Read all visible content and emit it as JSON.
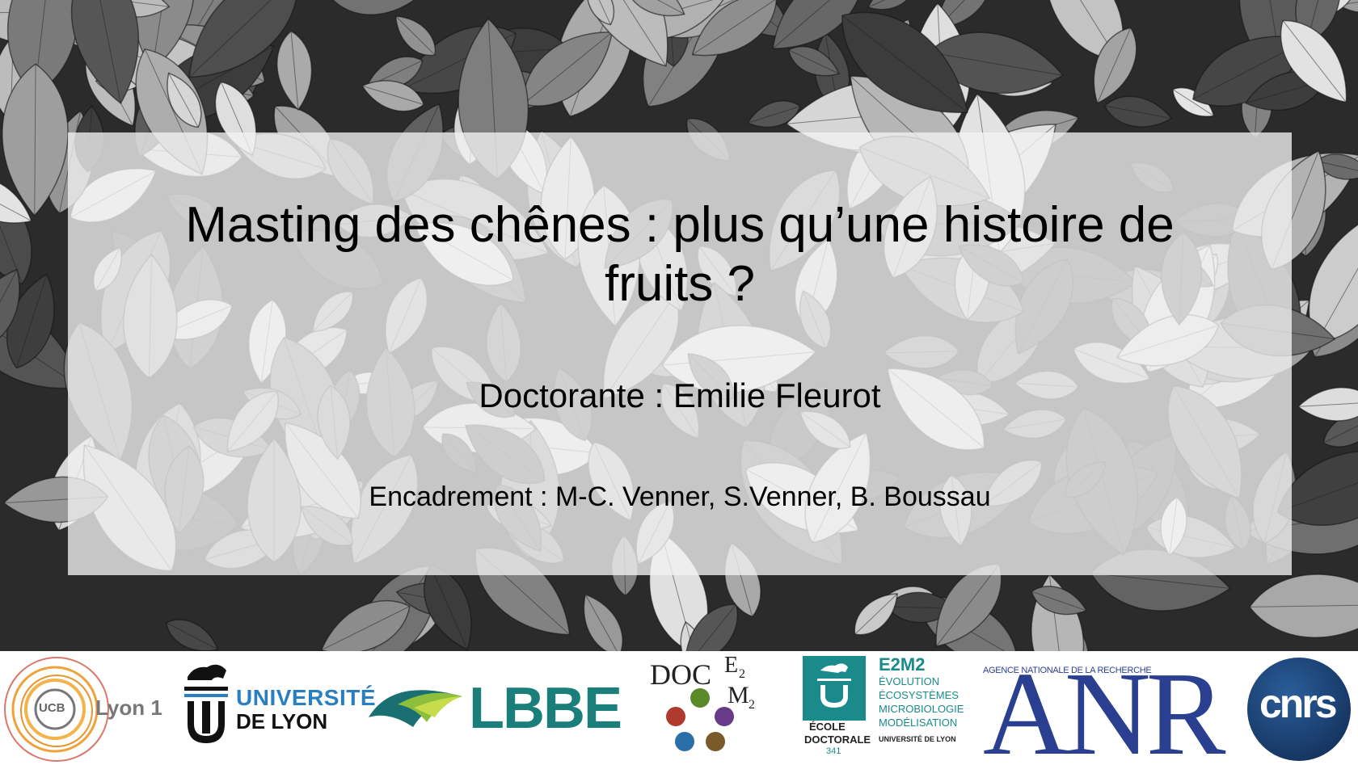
{
  "slide": {
    "title": "Masting des chênes : plus qu’une histoire de fruits ?",
    "author": "Doctorante : Emilie Fleurot",
    "supervision": "Encadrement : M-C. Venner, S.Venner, B. Boussau"
  },
  "logos": {
    "ucbl": {
      "seal": "UCB",
      "name": "Lyon 1",
      "icon": "ucbl-logo"
    },
    "universite_lyon": {
      "line1": "UNIVERSITÉ",
      "line2": "DE LYON",
      "icon": "lion-logo"
    },
    "lbbe": {
      "name": "LBBE",
      "icon": "leaf-logo"
    },
    "docem": {
      "name": "DOC",
      "sup_e": "E",
      "sub_2a": "2",
      "m": "M",
      "sub_2b": "2",
      "icon": "docem-logo"
    },
    "e2m2": {
      "ecole_line1": "ÉCOLE",
      "ecole_line2": "DOCTORALE",
      "number": "341",
      "title": "E2M2",
      "line1": "ÉVOLUTION",
      "line2": "ÉCOSYSTÈMES",
      "line3": "MICROBIOLOGIE",
      "line4": "MODÉLISATION",
      "line5": "UNIVERSITÉ DE LYON"
    },
    "anr": {
      "tagline": "AGENCE NATIONALE DE LA RECHERCHE",
      "letters": "ANR"
    },
    "cnrs": {
      "name": "cnrs"
    }
  },
  "colors": {
    "lyon_blue": "#2a7fc1",
    "lbbe_teal": "#1a7f7a",
    "e2m2_teal": "#1a8a8a",
    "anr_blue": "#2a3f8f",
    "cnrs_navy": "#1c3f6e"
  }
}
